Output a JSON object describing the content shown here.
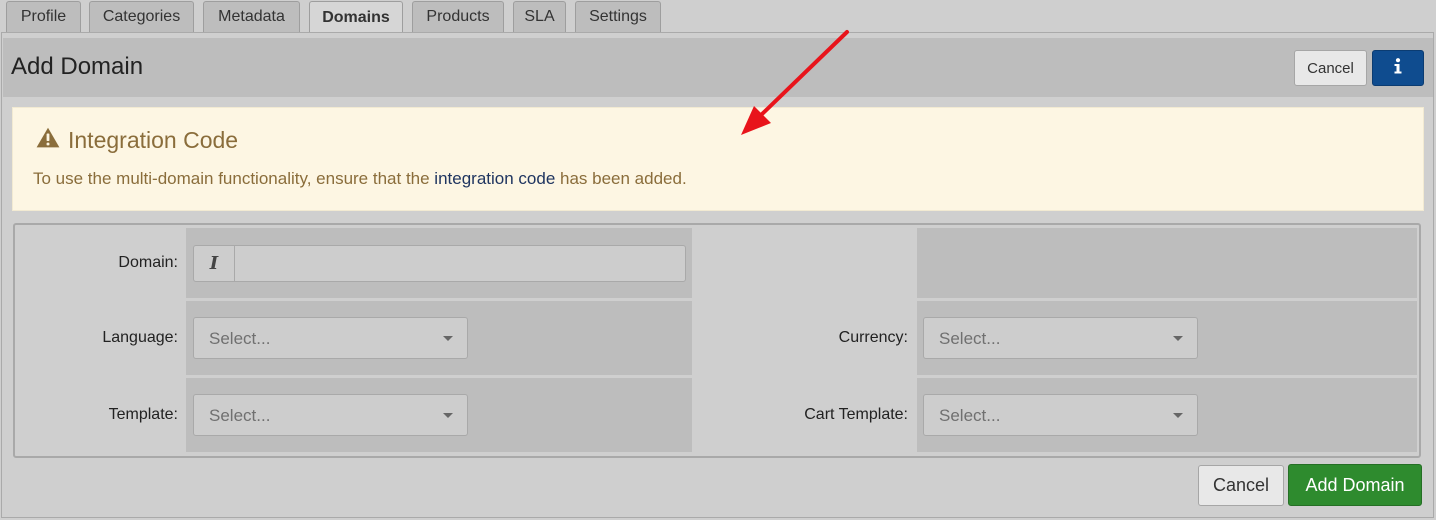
{
  "tabs": [
    {
      "label": "Profile",
      "active": false
    },
    {
      "label": "Categories",
      "active": false
    },
    {
      "label": "Metadata",
      "active": false
    },
    {
      "label": "Domains",
      "active": true
    },
    {
      "label": "Products",
      "active": false
    },
    {
      "label": "SLA",
      "active": false
    },
    {
      "label": "Settings",
      "active": false
    }
  ],
  "header": {
    "title": "Add Domain",
    "cancel_label": "Cancel",
    "info_icon": "info-icon"
  },
  "alert": {
    "icon": "warning-icon",
    "title": "Integration Code",
    "text_before": "To use the multi-domain functionality, ensure that the ",
    "link_text": "integration code",
    "text_after": " has been added."
  },
  "form": {
    "domain": {
      "label": "Domain:",
      "value": "",
      "addon_icon": "text-cursor-icon"
    },
    "language": {
      "label": "Language:",
      "placeholder": "Select..."
    },
    "currency": {
      "label": "Currency:",
      "placeholder": "Select..."
    },
    "template": {
      "label": "Template:",
      "placeholder": "Select..."
    },
    "cart_template": {
      "label": "Cart Template:",
      "placeholder": "Select..."
    }
  },
  "footer": {
    "cancel_label": "Cancel",
    "submit_label": "Add Domain"
  },
  "colors": {
    "primary": "#0f4c8f",
    "success": "#2e8b2e",
    "warning_text": "#8a6d3b",
    "warning_bg": "#fdf6e3",
    "annotation_arrow": "#e8141b"
  }
}
